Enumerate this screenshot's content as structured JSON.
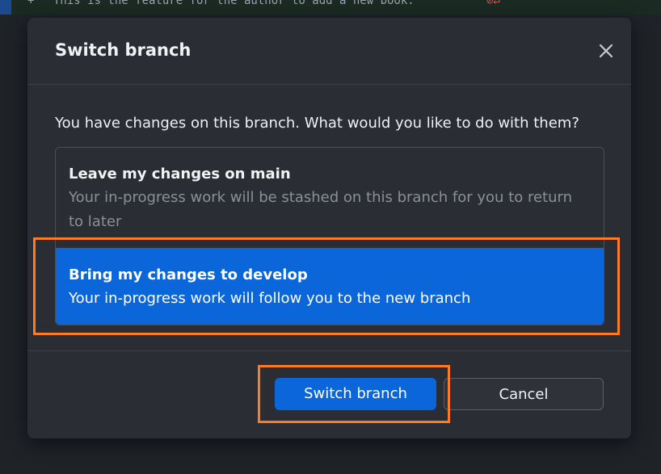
{
  "background": {
    "diff_prefix": "+",
    "code_line": "This is the feature for the author to add a new book.",
    "line_end_marks": "⊘↵"
  },
  "dialog": {
    "title": "Switch branch",
    "close_icon": "close-icon",
    "prompt": "You have changes on this branch. What would you like to do with them?",
    "options": [
      {
        "title": "Leave my changes on main",
        "description": "Your in-progress work will be stashed on this branch for you to return to later",
        "selected": false
      },
      {
        "title": "Bring my changes to develop",
        "description": "Your in-progress work will follow you to the new branch",
        "selected": true
      }
    ],
    "buttons": {
      "primary": "Switch branch",
      "secondary": "Cancel"
    }
  },
  "colors": {
    "accent": "#0b66d9",
    "highlight_box": "#ff7a22",
    "dialog_bg": "#2a2d33"
  }
}
